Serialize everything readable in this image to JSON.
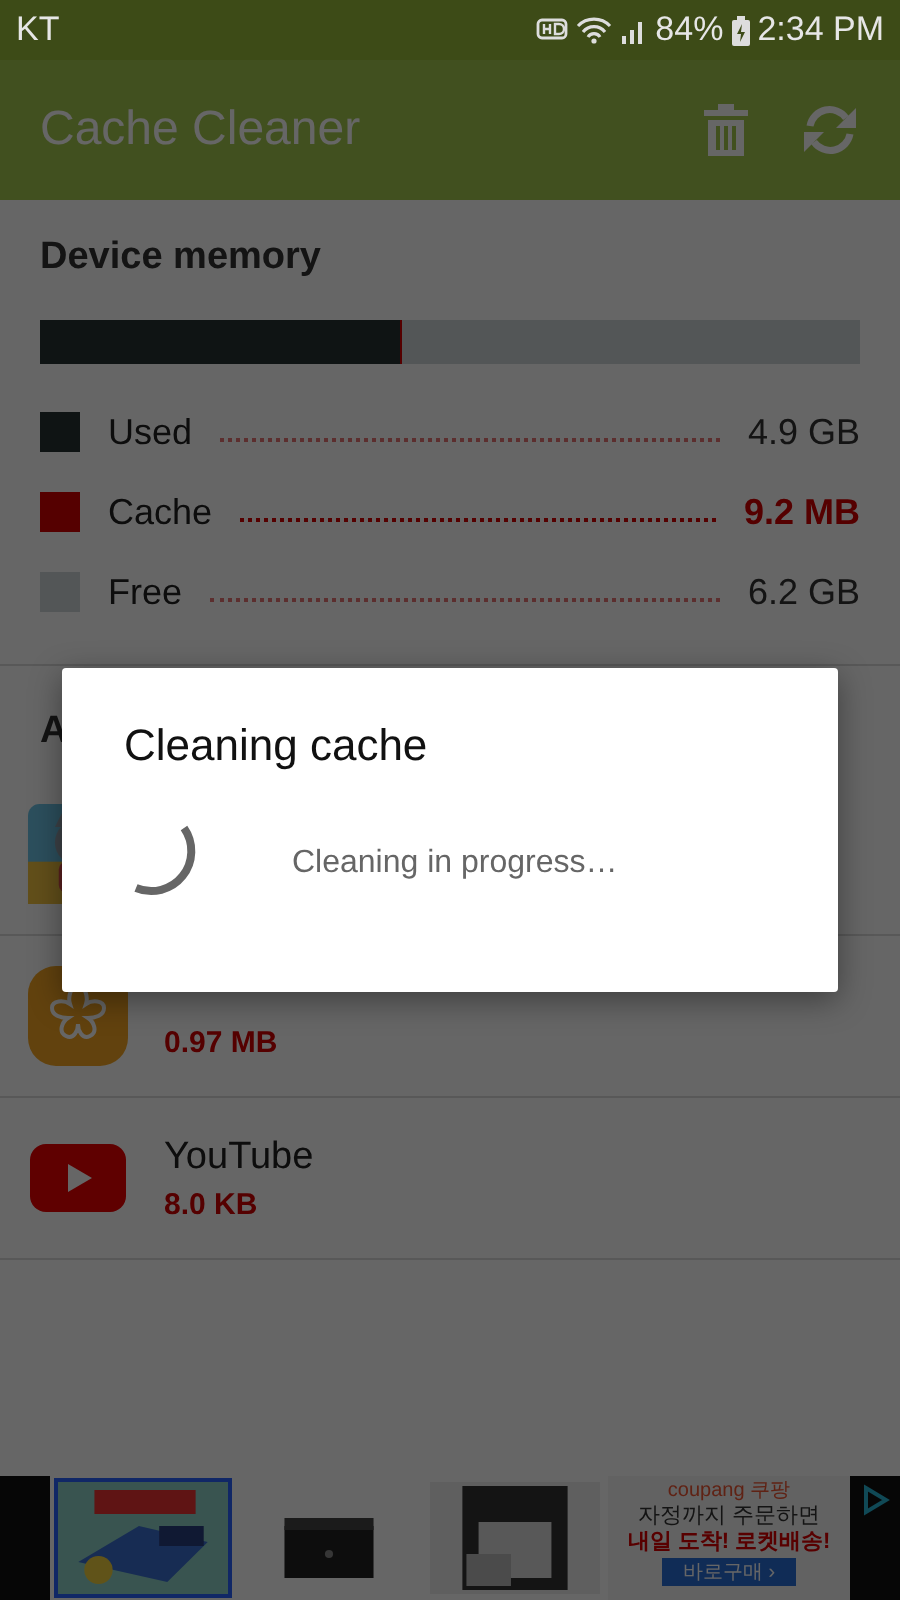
{
  "status_bar": {
    "carrier": "KT",
    "battery": "84%",
    "time": "2:34 PM"
  },
  "app_bar": {
    "title": "Cache Cleaner"
  },
  "memory": {
    "title": "Device memory",
    "legend": [
      {
        "label": "Used",
        "value": "4.9 GB",
        "color": "#0f1414",
        "level": 0.44,
        "highlight": false
      },
      {
        "label": "Cache",
        "value": "9.2 MB",
        "color": "#550000",
        "level": 0.002,
        "highlight": true
      },
      {
        "label": "Free",
        "value": "6.2 GB",
        "color": "#535657",
        "level": 0.558,
        "highlight": false
      }
    ]
  },
  "apps": {
    "title": "A",
    "items": [
      {
        "kind": "picture"
      },
      {
        "kind": "gallery",
        "size": "0.97 MB"
      },
      {
        "kind": "youtube",
        "name": "YouTube",
        "size": "8.0 KB"
      }
    ]
  },
  "dialog": {
    "title": "Cleaning cache",
    "message": "Cleaning in progress…"
  },
  "ad": {
    "brand": "coupang 쿠팡",
    "line_1": "자정까지 주문하면",
    "line_2": "내일 도착! 로켓배송!",
    "button": "바로구매 ›"
  }
}
